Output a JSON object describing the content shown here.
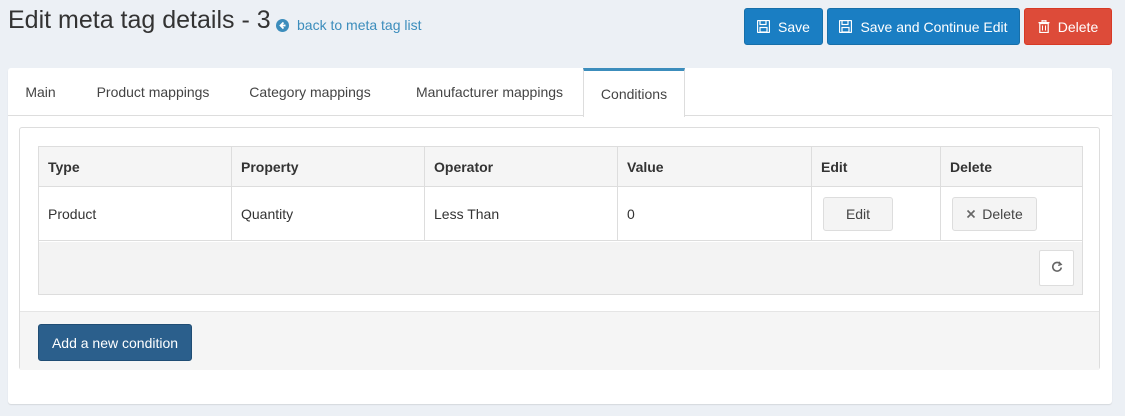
{
  "header": {
    "title": "Edit meta tag details - 3",
    "back_link": "back to meta tag list"
  },
  "actions": {
    "save": "Save",
    "save_continue": "Save and Continue Edit",
    "delete": "Delete"
  },
  "colors": {
    "primary": "#1a7ec3",
    "danger": "#dd4b39",
    "link": "#3c8dbc",
    "add_button": "#2b5f8c"
  },
  "tabs": [
    {
      "label": "Main"
    },
    {
      "label": "Product mappings"
    },
    {
      "label": "Category mappings"
    },
    {
      "label": "Manufacturer mappings"
    },
    {
      "label": "Conditions",
      "active": true
    }
  ],
  "grid": {
    "columns": [
      "Type",
      "Property",
      "Operator",
      "Value",
      "Edit",
      "Delete"
    ],
    "rows": [
      {
        "type": "Product",
        "property": "Quantity",
        "operator": "Less Than",
        "value": "0",
        "edit": "Edit",
        "delete": "Delete"
      }
    ],
    "refresh_icon": "refresh-icon"
  },
  "footer": {
    "add_condition": "Add a new condition"
  }
}
